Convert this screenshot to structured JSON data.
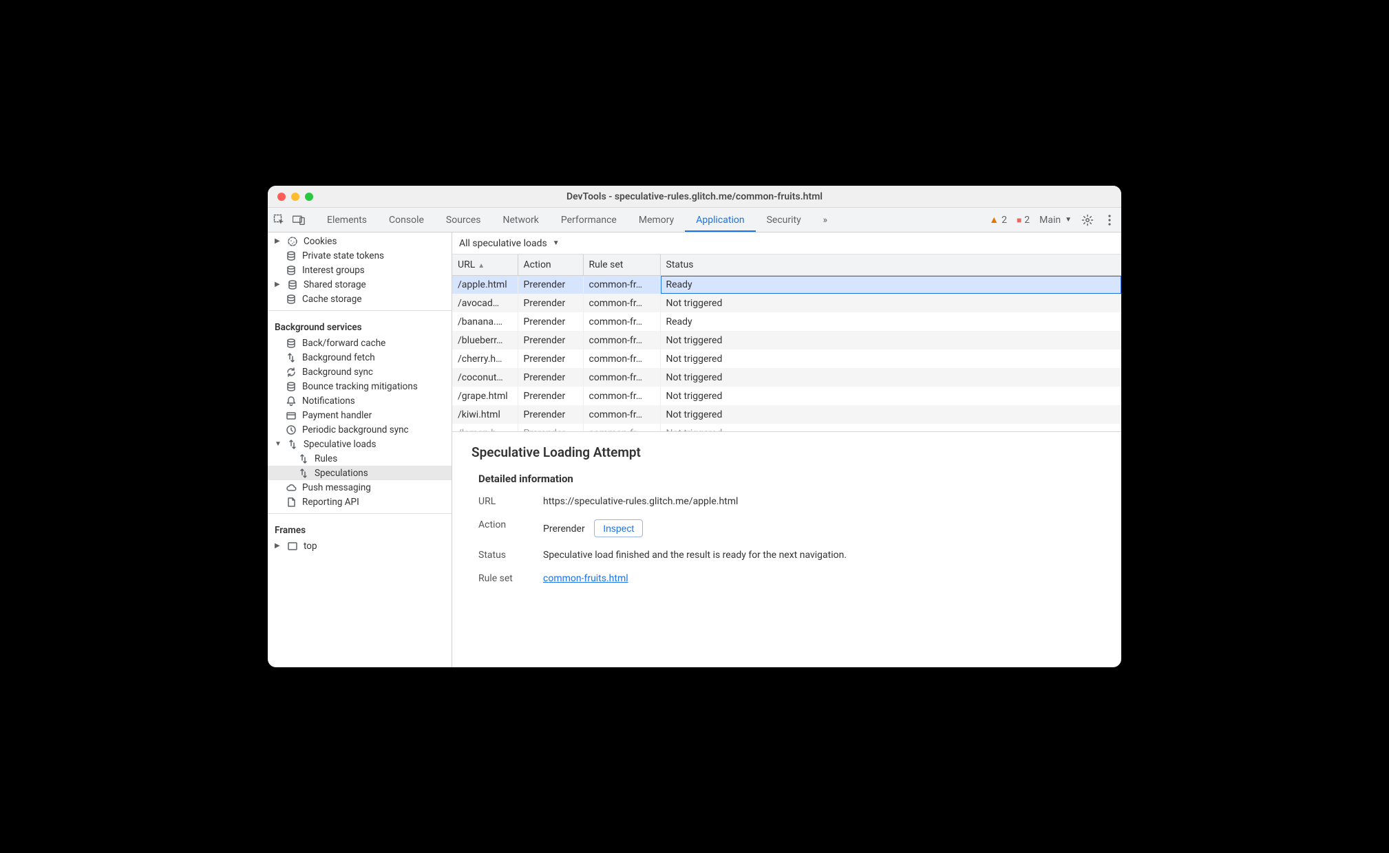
{
  "window": {
    "title": "DevTools - speculative-rules.glitch.me/common-fruits.html"
  },
  "tabs": {
    "items": [
      "Elements",
      "Console",
      "Sources",
      "Network",
      "Performance",
      "Memory",
      "Application",
      "Security"
    ],
    "active": "Application",
    "overflow": "»",
    "warn_count": "2",
    "issue_count": "2",
    "target_label": "Main"
  },
  "sidebar": {
    "storage": [
      {
        "label": "Cookies",
        "arrow": true,
        "icon": "cookie"
      },
      {
        "label": "Private state tokens",
        "icon": "db"
      },
      {
        "label": "Interest groups",
        "icon": "db"
      },
      {
        "label": "Shared storage",
        "arrow": true,
        "icon": "db"
      },
      {
        "label": "Cache storage",
        "icon": "db"
      }
    ],
    "bg_header": "Background services",
    "bg": [
      {
        "label": "Back/forward cache",
        "icon": "db"
      },
      {
        "label": "Background fetch",
        "icon": "arrows"
      },
      {
        "label": "Background sync",
        "icon": "sync"
      },
      {
        "label": "Bounce tracking mitigations",
        "icon": "db"
      },
      {
        "label": "Notifications",
        "icon": "bell"
      },
      {
        "label": "Payment handler",
        "icon": "card"
      },
      {
        "label": "Periodic background sync",
        "icon": "clock"
      },
      {
        "label": "Speculative loads",
        "arrow": true,
        "open": true,
        "icon": "arrows",
        "children": [
          {
            "label": "Rules"
          },
          {
            "label": "Speculations",
            "selected": true
          }
        ]
      },
      {
        "label": "Push messaging",
        "icon": "cloud"
      },
      {
        "label": "Reporting API",
        "icon": "doc"
      }
    ],
    "frames_header": "Frames",
    "frames": [
      {
        "label": "top",
        "arrow": true,
        "icon": "frame"
      }
    ]
  },
  "filter": {
    "label": "All speculative loads"
  },
  "table": {
    "headers": [
      "URL",
      "Action",
      "Rule set",
      "Status"
    ],
    "col_widths": [
      "95px",
      "95px",
      "110px",
      "auto"
    ],
    "rows": [
      {
        "url": "/apple.html",
        "action": "Prerender",
        "ruleset": "common-fr…",
        "status": "Ready",
        "selected": true
      },
      {
        "url": "/avocad…",
        "action": "Prerender",
        "ruleset": "common-fr…",
        "status": "Not triggered"
      },
      {
        "url": "/banana.…",
        "action": "Prerender",
        "ruleset": "common-fr…",
        "status": "Ready"
      },
      {
        "url": "/blueberr…",
        "action": "Prerender",
        "ruleset": "common-fr…",
        "status": "Not triggered"
      },
      {
        "url": "/cherry.h…",
        "action": "Prerender",
        "ruleset": "common-fr…",
        "status": "Not triggered"
      },
      {
        "url": "/coconut…",
        "action": "Prerender",
        "ruleset": "common-fr…",
        "status": "Not triggered"
      },
      {
        "url": "/grape.html",
        "action": "Prerender",
        "ruleset": "common-fr…",
        "status": "Not triggered"
      },
      {
        "url": "/kiwi.html",
        "action": "Prerender",
        "ruleset": "common-fr…",
        "status": "Not triggered"
      },
      {
        "url": "/lemon.h…",
        "action": "Prerender",
        "ruleset": "common-fr…",
        "status": "Not triggered",
        "peek": true
      }
    ]
  },
  "details": {
    "heading": "Speculative Loading Attempt",
    "section": "Detailed information",
    "url_label": "URL",
    "url_value": "https://speculative-rules.glitch.me/apple.html",
    "action_label": "Action",
    "action_value": "Prerender",
    "inspect_label": "Inspect",
    "status_label": "Status",
    "status_value": "Speculative load finished and the result is ready for the next navigation.",
    "ruleset_label": "Rule set",
    "ruleset_value": "common-fruits.html"
  }
}
